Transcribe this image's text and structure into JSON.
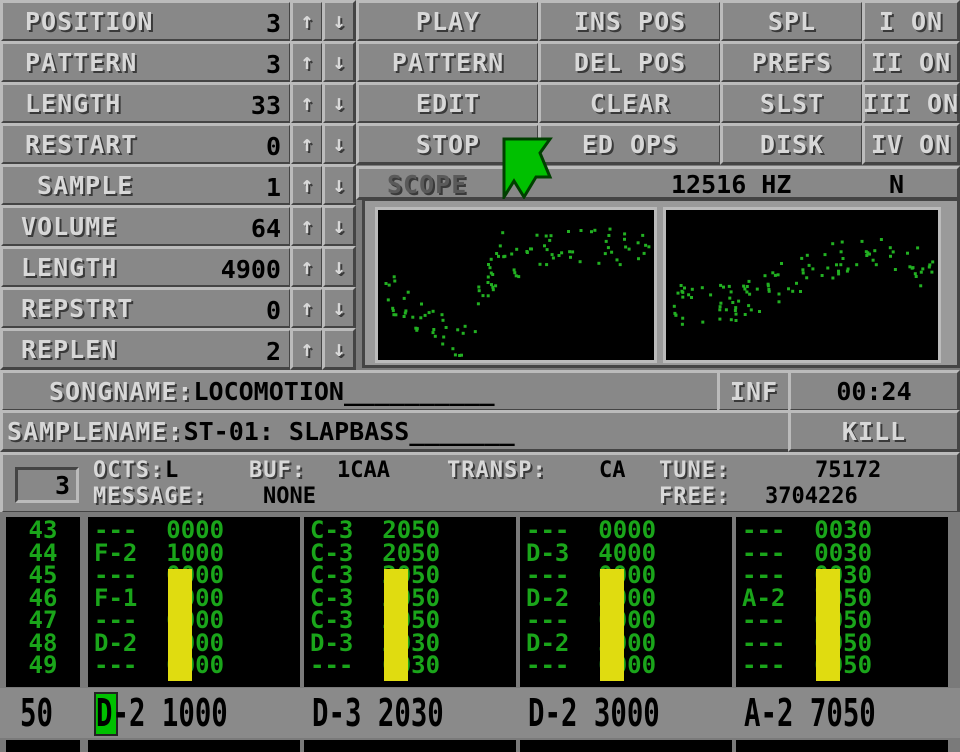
{
  "song_controls": [
    {
      "label": "POSITION",
      "value": "3"
    },
    {
      "label": "PATTERN",
      "value": "3"
    },
    {
      "label": "LENGTH",
      "value": "33"
    },
    {
      "label": "RESTART",
      "value": "0"
    }
  ],
  "sample_controls": [
    {
      "label": "SAMPLE",
      "value": "1"
    },
    {
      "label": "VOLUME",
      "value": "64"
    },
    {
      "label": "LENGTH",
      "value": "4900"
    },
    {
      "label": "REPSTRT",
      "value": "0"
    },
    {
      "label": "REPLEN",
      "value": "2"
    }
  ],
  "arrows": {
    "up": "↑",
    "down": "↓"
  },
  "buttons": {
    "col1": [
      "PLAY",
      "PATTERN",
      "EDIT",
      "STOP"
    ],
    "col2": [
      "INS POS",
      "DEL POS",
      "CLEAR",
      "ED OPS"
    ],
    "col3": [
      "SPL",
      "PREFS",
      "SLST",
      "DISK"
    ],
    "channels": [
      "I ON",
      "II ON",
      "III ON",
      "IV ON"
    ]
  },
  "scope": {
    "label": "SCOPE",
    "rate": "12516 HZ",
    "mode": "N"
  },
  "songname": {
    "label": "SONGNAME:",
    "value": "LOCOMOTION__________"
  },
  "info_button": "INF",
  "time": "00:24",
  "samplename": {
    "label": "SAMPLENAME:",
    "value": "ST-01: SLAPBASS_______"
  },
  "kill_button": "KILL",
  "status": {
    "edit_skip": "3",
    "octs_label": "OCTS:",
    "octs_value": "L",
    "buf_label": "BUF:",
    "buf_value": "1CAA",
    "transp_label": "TRANSP:",
    "transp_value": "CA",
    "tune_label": "TUNE:",
    "tune_value": "75172",
    "message_label": "MESSAGE:",
    "message_value": "NONE",
    "free_label": "FREE:",
    "free_value": "3704226"
  },
  "pattern": {
    "row_numbers": [
      "43",
      "44",
      "45",
      "46",
      "47",
      "48",
      "49"
    ],
    "current_row": "50",
    "tracks": [
      {
        "rows": [
          "---  0000",
          "F-2  1000",
          "---  0000",
          "F-1  1000",
          "---  0000",
          "D-2  1000",
          "---  0000"
        ],
        "current": "D-2 1000",
        "vu_level": 0.75
      },
      {
        "rows": [
          "C-3  2050",
          "C-3  2050",
          "C-3  2050",
          "C-3  2050",
          "C-3  2050",
          "D-3  2030",
          "---  0030"
        ],
        "current": "D-3 2030",
        "vu_level": 0.75
      },
      {
        "rows": [
          "---  0000",
          "D-3  4000",
          "---  0000",
          "D-2  3000",
          "---  0000",
          "D-2  3000",
          "---  0000"
        ],
        "current": "D-2 3000",
        "vu_level": 0.75
      },
      {
        "rows": [
          "---  0030",
          "---  0030",
          "---  0030",
          "A-2  7050",
          "---  0050",
          "---  0050",
          "---  0050"
        ],
        "current": "A-2 7050",
        "vu_level": 0.75
      }
    ]
  },
  "colors": {
    "pattern_text": "#1aa51a",
    "vu": "#e0dc10",
    "cursor": "#00c000",
    "panel": "#888888"
  }
}
